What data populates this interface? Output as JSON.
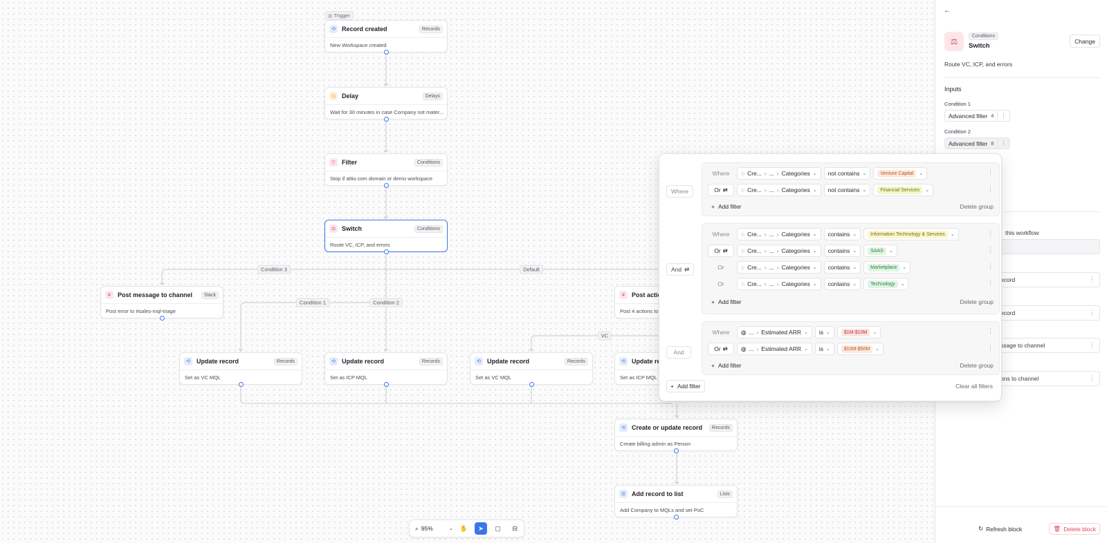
{
  "canvas": {
    "trigger_label": "Trigger",
    "nodes": [
      {
        "id": "n1",
        "icon": "record-icon",
        "title": "Record created",
        "tag": "Records",
        "desc": "New Workspace created"
      },
      {
        "id": "n2",
        "icon": "clock-icon",
        "title": "Delay",
        "tag": "Delays",
        "desc": "Wait for 30 minutes in case Company not mater..."
      },
      {
        "id": "n3",
        "icon": "filter-icon",
        "title": "Filter",
        "tag": "Conditions",
        "desc": "Stop if attio.com domain or demo workspace"
      },
      {
        "id": "n4",
        "icon": "switch-icon",
        "title": "Switch",
        "tag": "Conditions",
        "desc": "Route VC, ICP, and errors"
      },
      {
        "id": "n5",
        "icon": "slack-icon",
        "title": "Post message to channel",
        "tag": "Slack",
        "desc": "Post error to #sales-mql-triage"
      },
      {
        "id": "n6",
        "icon": "slack-icon",
        "title": "Post action",
        "tag": "",
        "desc": "Post 4 actions to"
      },
      {
        "id": "n7",
        "icon": "record-icon",
        "title": "Update record",
        "tag": "Records",
        "desc": "Set as VC MQL"
      },
      {
        "id": "n8",
        "icon": "record-icon",
        "title": "Update record",
        "tag": "Records",
        "desc": "Set as ICP MQL"
      },
      {
        "id": "n9",
        "icon": "record-icon",
        "title": "Update record",
        "tag": "Records",
        "desc": "Set as VC MQL"
      },
      {
        "id": "n10",
        "icon": "record-icon",
        "title": "Update re",
        "tag": "",
        "desc": "Set as ICP MQL"
      },
      {
        "id": "n11",
        "icon": "record-icon",
        "title": "Create or update record",
        "tag": "Records",
        "desc": "Create billing admin as Person"
      },
      {
        "id": "n12",
        "icon": "list-icon",
        "title": "Add record to list",
        "tag": "Lists",
        "desc": "Add Company to MQLs and set PoC"
      }
    ],
    "edge_labels": {
      "condition3": "Condition 3",
      "default": "Default",
      "condition1": "Condition 1",
      "condition2": "Condition 2",
      "vc": "VC"
    }
  },
  "toolbar": {
    "zoom": "95%"
  },
  "panel": {
    "category": "Conditions",
    "name": "Switch",
    "change_label": "Change",
    "description": "Route VC, ICP, and errors",
    "inputs_title": "Inputs",
    "condition1_label": "Condition 1",
    "condition1_filter": "Advanced filter",
    "condition1_count": "4",
    "condition2_label": "Condition 2",
    "condition2_filter": "Advanced filter",
    "condition2_count": "8",
    "workflow_hint": "this workflow",
    "rows": [
      "ecord",
      "ecord",
      "ssage to channel",
      "ons to channel"
    ],
    "refresh_label": "Refresh block",
    "delete_label": "Delete block"
  },
  "popover": {
    "groups": [
      {
        "connector": "Where",
        "rows": [
          {
            "conn": "Where",
            "conn_box": false,
            "attr_prefix": "Cre...",
            "attr_mid": "...",
            "attr": "Categories",
            "op": "not contains",
            "value": "Venture Capital",
            "chip_bg": "#fde9dd",
            "chip_fg": "#b4541c"
          },
          {
            "conn": "Or",
            "conn_box": true,
            "attr_prefix": "Cre...",
            "attr_mid": "...",
            "attr": "Categories",
            "op": "not contains",
            "value": "Financial Services",
            "chip_bg": "#f3f7c9",
            "chip_fg": "#6c7a12"
          }
        ],
        "add_filter": "Add filter",
        "delete_group": "Delete group"
      },
      {
        "connector": "And",
        "rows": [
          {
            "conn": "Where",
            "conn_box": false,
            "attr_prefix": "Cre...",
            "attr_mid": "...",
            "attr": "Categories",
            "op": "contains",
            "value": "Information Technology & Services",
            "chip_bg": "#fbf6cf",
            "chip_fg": "#7d6a10"
          },
          {
            "conn": "Or",
            "conn_box": true,
            "attr_prefix": "Cre...",
            "attr_mid": "...",
            "attr": "Categories",
            "op": "contains",
            "value": "SAAS",
            "chip_bg": "#dff5e3",
            "chip_fg": "#2a7d3e"
          },
          {
            "conn": "Or",
            "conn_box": false,
            "attr_prefix": "Cre...",
            "attr_mid": "...",
            "attr": "Categories",
            "op": "contains",
            "value": "Marketplace",
            "chip_bg": "#dff5e3",
            "chip_fg": "#2a7d3e"
          },
          {
            "conn": "Or",
            "conn_box": false,
            "attr_prefix": "Cre...",
            "attr_mid": "...",
            "attr": "Categories",
            "op": "contains",
            "value": "Technology",
            "chip_bg": "#dff5e3",
            "chip_fg": "#2a7d3e"
          }
        ],
        "add_filter": "Add filter",
        "delete_group": "Delete group"
      },
      {
        "connector": "And",
        "rows": [
          {
            "conn": "Where",
            "conn_box": false,
            "attr_prefix": "...",
            "attr_mid": "",
            "attr": "Estimated ARR",
            "op": "is",
            "value": "$1M-$10M",
            "chip_bg": "#fde3e3",
            "chip_fg": "#b4342c"
          },
          {
            "conn": "Or",
            "conn_box": true,
            "attr_prefix": "...",
            "attr_mid": "",
            "attr": "Estimated ARR",
            "op": "is",
            "value": "$10M-$50M",
            "chip_bg": "#fde9dd",
            "chip_fg": "#b4541c"
          }
        ],
        "add_filter": "Add filter",
        "delete_group": "Delete group"
      }
    ],
    "add_filter": "Add filter",
    "clear_all": "Clear all filters"
  },
  "colors": {
    "accent": "#3b76e8",
    "danger": "#e0485a"
  }
}
